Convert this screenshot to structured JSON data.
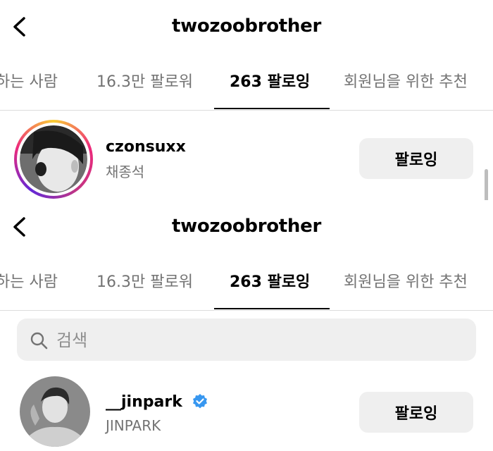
{
  "colors": {
    "background": "#ffffff",
    "text_primary": "#000000",
    "text_secondary": "#737373",
    "button_bg": "#efefef",
    "divider": "#dcdcdc",
    "verified_blue": "#3797f0"
  },
  "screens": [
    {
      "header": {
        "title": "twozoobrother",
        "back_icon": "chevron-left-icon"
      },
      "tabs": [
        {
          "label": "하는 사람",
          "active": false
        },
        {
          "label": "16.3만 팔로워",
          "active": false
        },
        {
          "label": "263 팔로잉",
          "active": true
        },
        {
          "label": "회원님을 위한 추천",
          "active": false
        }
      ],
      "users": [
        {
          "username": "czonsuxx",
          "full_name": "채종석",
          "button_label": "팔로잉",
          "story_ring": true,
          "verified": false
        }
      ]
    },
    {
      "header": {
        "title": "twozoobrother",
        "back_icon": "chevron-left-icon"
      },
      "tabs": [
        {
          "label": "하는 사람",
          "active": false
        },
        {
          "label": "16.3만 팔로워",
          "active": false
        },
        {
          "label": "263 팔로잉",
          "active": true
        },
        {
          "label": "회원님을 위한 추천",
          "active": false
        }
      ],
      "search": {
        "placeholder": "검색",
        "value": "",
        "icon": "search-icon"
      },
      "users": [
        {
          "username": "__jinpark",
          "full_name": "JINPARK",
          "button_label": "팔로잉",
          "story_ring": false,
          "verified": true
        }
      ]
    }
  ]
}
